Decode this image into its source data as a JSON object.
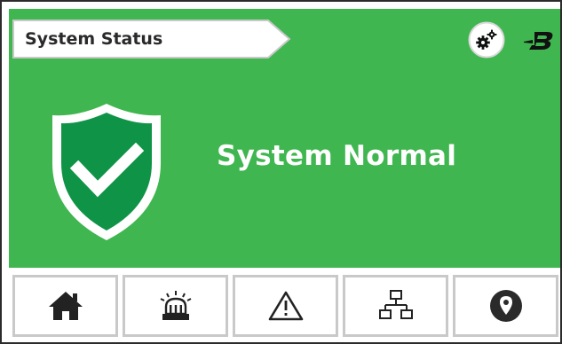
{
  "header": {
    "title": "System Status",
    "settings_icon": "gears-icon",
    "logo_icon": "brand-b-logo"
  },
  "status": {
    "text": "System Normal",
    "icon": "shield-check-icon",
    "color": "#3fb64f",
    "shield_color": "#0f9447"
  },
  "nav": {
    "items": [
      {
        "icon": "home-icon",
        "label": "Home"
      },
      {
        "icon": "alarm-beacon-icon",
        "label": "Alarms"
      },
      {
        "icon": "warning-icon",
        "label": "Warnings"
      },
      {
        "icon": "network-icon",
        "label": "Network"
      },
      {
        "icon": "location-pin-icon",
        "label": "Location"
      }
    ]
  }
}
